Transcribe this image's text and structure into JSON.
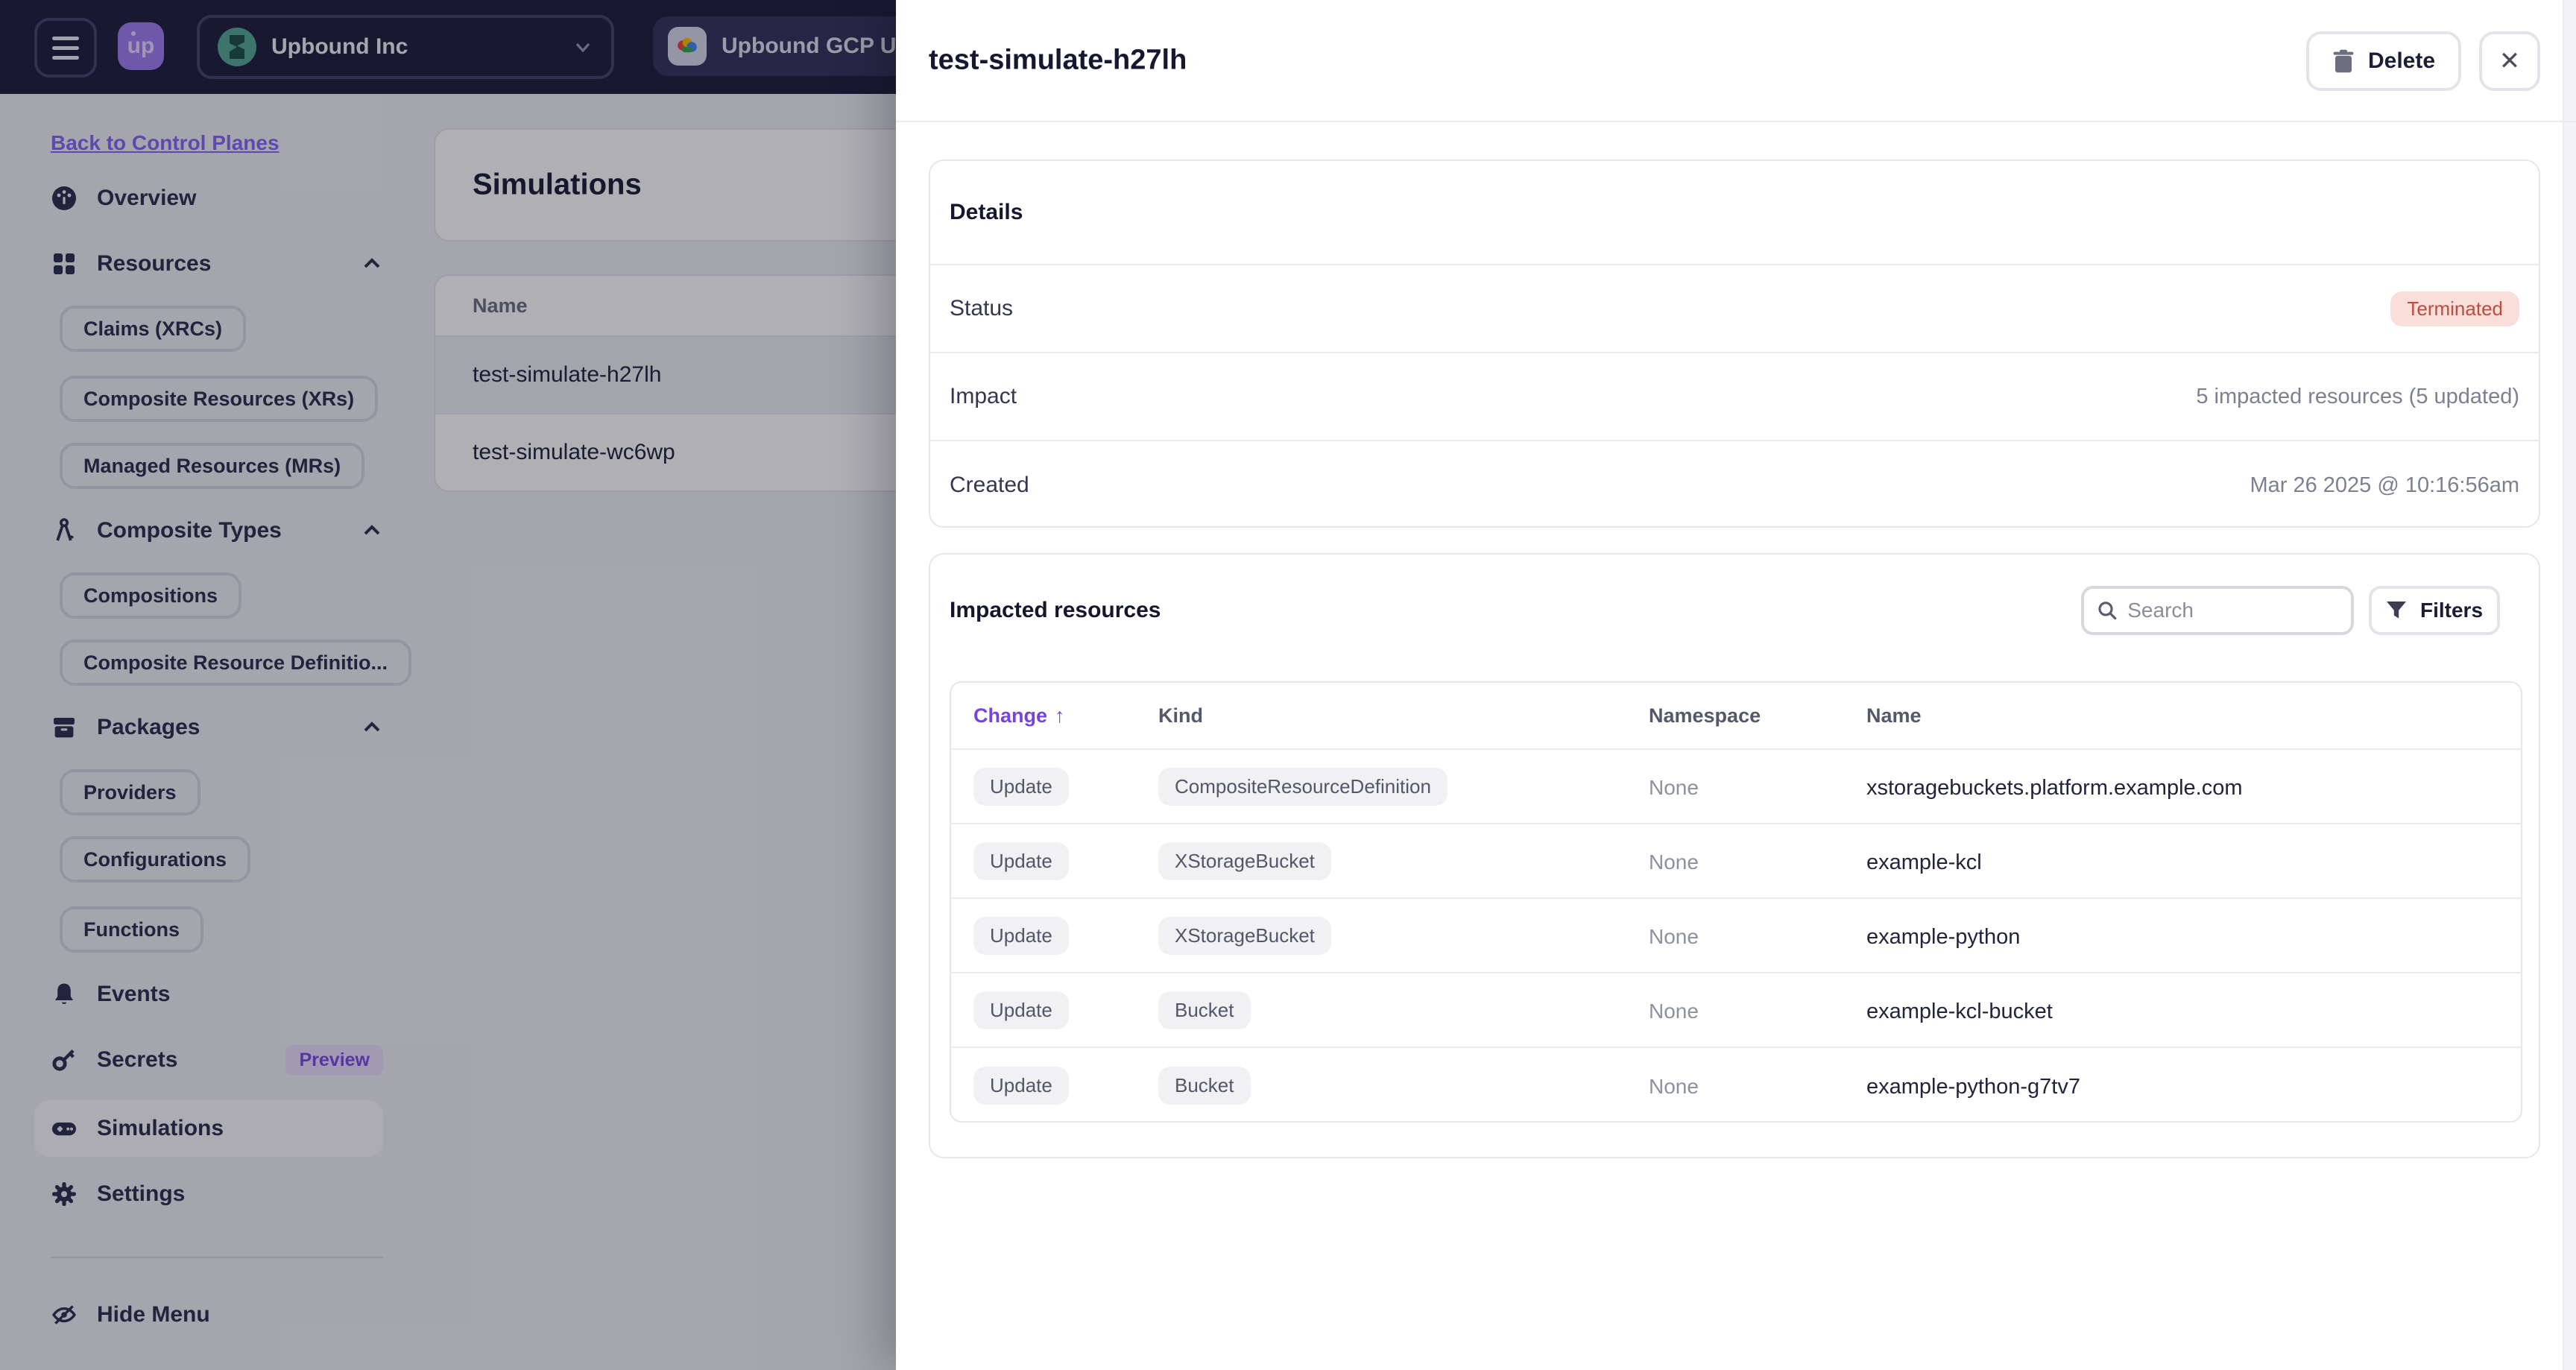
{
  "topbar": {
    "logo_label": "up",
    "org_name": "Upbound Inc",
    "tab_name": "Upbound GCP U",
    "org_chevron": "⌄"
  },
  "sidebar": {
    "back_link": "Back to Control Planes",
    "overview": "Overview",
    "resources": "Resources",
    "resources_items": [
      "Claims (XRCs)",
      "Composite Resources (XRs)",
      "Managed Resources (MRs)"
    ],
    "composite_types": "Composite Types",
    "composite_items": [
      "Compositions",
      "Composite Resource Definitio..."
    ],
    "packages": "Packages",
    "packages_items": [
      "Providers",
      "Configurations",
      "Functions"
    ],
    "events": "Events",
    "secrets": "Secrets",
    "secrets_badge": "Preview",
    "simulations": "Simulations",
    "settings": "Settings",
    "hide_menu": "Hide Menu"
  },
  "main": {
    "title": "Simulations",
    "table": {
      "header": "Name",
      "rows": [
        "test-simulate-h27lh",
        "test-simulate-wc6wp"
      ]
    }
  },
  "panel": {
    "title": "test-simulate-h27lh",
    "delete_label": "Delete",
    "close_glyph": "✕",
    "details": {
      "title": "Details",
      "status_label": "Status",
      "status_value": "Terminated",
      "impact_label": "Impact",
      "impact_value": "5 impacted resources (5 updated)",
      "created_label": "Created",
      "created_value": "Mar 26 2025 @ 10:16:56am"
    },
    "impacted": {
      "title": "Impacted resources",
      "search_placeholder": "Search",
      "filters_label": "Filters",
      "sort_arrow": "↑",
      "columns": {
        "change": "Change",
        "kind": "Kind",
        "namespace": "Namespace",
        "name": "Name"
      },
      "rows": [
        {
          "change": "Update",
          "kind": "CompositeResourceDefinition",
          "namespace": "None",
          "name": "xstoragebuckets.platform.example.com"
        },
        {
          "change": "Update",
          "kind": "XStorageBucket",
          "namespace": "None",
          "name": "example-kcl"
        },
        {
          "change": "Update",
          "kind": "XStorageBucket",
          "namespace": "None",
          "name": "example-python"
        },
        {
          "change": "Update",
          "kind": "Bucket",
          "namespace": "None",
          "name": "example-kcl-bucket"
        },
        {
          "change": "Update",
          "kind": "Bucket",
          "namespace": "None",
          "name": "example-python-g7tv7"
        }
      ]
    }
  },
  "colors": {
    "accent_purple": "#7544e0",
    "terminated_bg": "#f9ded9",
    "terminated_text": "#bf4a3e",
    "topbar_bg": "#1e1e3c",
    "panel_bg": "#ffffff"
  }
}
